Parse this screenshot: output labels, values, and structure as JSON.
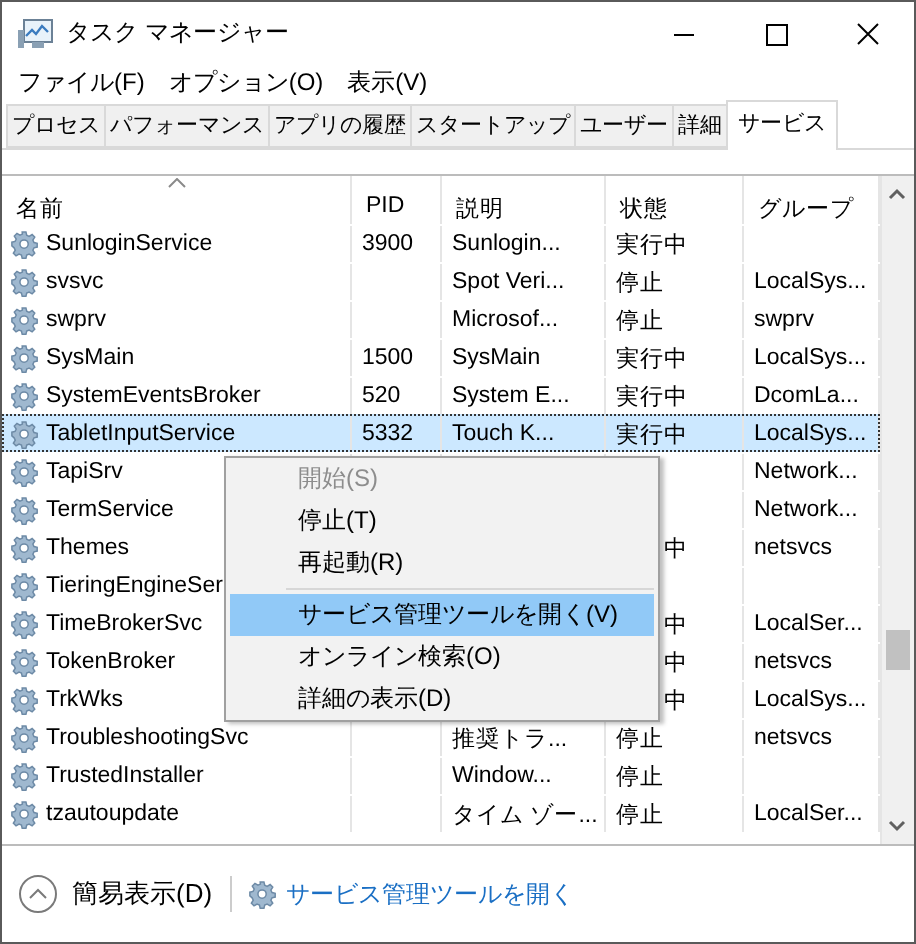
{
  "window": {
    "title": "タスク マネージャー"
  },
  "menu_bar": [
    "ファイル(F)",
    "オプション(O)",
    "表示(V)"
  ],
  "tabs": [
    {
      "label": "プロセス",
      "selected": false
    },
    {
      "label": "パフォーマンス",
      "selected": false
    },
    {
      "label": "アプリの履歴",
      "selected": false
    },
    {
      "label": "スタートアップ",
      "selected": false
    },
    {
      "label": "ユーザー",
      "selected": false
    },
    {
      "label": "詳細",
      "selected": false
    },
    {
      "label": "サービス",
      "selected": true
    }
  ],
  "table": {
    "columns": [
      {
        "label": "名前",
        "sorted": true
      },
      {
        "label": "PID",
        "sorted": false
      },
      {
        "label": "説明",
        "sorted": false
      },
      {
        "label": "状態",
        "sorted": false
      },
      {
        "label": "グループ",
        "sorted": false
      }
    ],
    "rows": [
      {
        "name": "SunloginService",
        "pid": "3900",
        "description": "Sunlogin...",
        "status": "実行中",
        "group": "",
        "selected": false,
        "covered": false
      },
      {
        "name": "svsvc",
        "pid": "",
        "description": "Spot Veri...",
        "status": "停止",
        "group": "LocalSys...",
        "selected": false,
        "covered": false
      },
      {
        "name": "swprv",
        "pid": "",
        "description": "Microsof...",
        "status": "停止",
        "group": "swprv",
        "selected": false,
        "covered": false
      },
      {
        "name": "SysMain",
        "pid": "1500",
        "description": "SysMain",
        "status": "実行中",
        "group": "LocalSys...",
        "selected": false,
        "covered": false
      },
      {
        "name": "SystemEventsBroker",
        "pid": "520",
        "description": "System E...",
        "status": "実行中",
        "group": "DcomLa...",
        "selected": false,
        "covered": false
      },
      {
        "name": "TabletInputService",
        "pid": "5332",
        "description": "Touch K...",
        "status": "実行中",
        "group": "LocalSys...",
        "selected": true,
        "covered": false
      },
      {
        "name": "TapiSrv",
        "pid": "",
        "description": "",
        "status": "",
        "group": "Network...",
        "selected": false
      },
      {
        "name": "TermService",
        "pid": "",
        "description": "",
        "status": "",
        "group": "Network...",
        "selected": false
      },
      {
        "name": "Themes",
        "pid": "",
        "description": "",
        "status": "中",
        "group": "netsvcs",
        "selected": false,
        "covered": true
      },
      {
        "name": "TieringEngineSer",
        "pid": "",
        "description": "",
        "status": "",
        "group": "",
        "selected": false
      },
      {
        "name": "TimeBrokerSvc",
        "pid": "",
        "description": "",
        "status": "中",
        "group": "LocalSer...",
        "selected": false,
        "covered": true
      },
      {
        "name": "TokenBroker",
        "pid": "",
        "description": "",
        "status": "中",
        "group": "netsvcs",
        "selected": false,
        "covered": true
      },
      {
        "name": "TrkWks",
        "pid": "",
        "description": "",
        "status": "中",
        "group": "LocalSys...",
        "selected": false,
        "covered": true
      },
      {
        "name": "TroubleshootingSvc",
        "pid": "",
        "description": "推奨トラ...",
        "status": "停止",
        "group": "netsvcs",
        "selected": false,
        "covered": false
      },
      {
        "name": "TrustedInstaller",
        "pid": "",
        "description": "Window...",
        "status": "停止",
        "group": "",
        "selected": false,
        "covered": false
      },
      {
        "name": "tzautoupdate",
        "pid": "",
        "description": "タイム ゾー...",
        "status": "停止",
        "group": "LocalSer...",
        "selected": false,
        "covered": false
      }
    ]
  },
  "context_menu": [
    {
      "kind": "item",
      "label": "開始(S)",
      "disabled": true,
      "highlighted": false
    },
    {
      "kind": "item",
      "label": "停止(T)",
      "disabled": false,
      "highlighted": false
    },
    {
      "kind": "item",
      "label": "再起動(R)",
      "disabled": false,
      "highlighted": false
    },
    {
      "kind": "separator"
    },
    {
      "kind": "item",
      "label": "サービス管理ツールを開く(V)",
      "disabled": false,
      "highlighted": true
    },
    {
      "kind": "item",
      "label": "オンライン検索(O)",
      "disabled": false,
      "highlighted": false
    },
    {
      "kind": "item",
      "label": "詳細の表示(D)",
      "disabled": false,
      "highlighted": false
    }
  ],
  "footer": {
    "fewer_details": "簡易表示(D)",
    "link": "サービス管理ツールを開く"
  }
}
